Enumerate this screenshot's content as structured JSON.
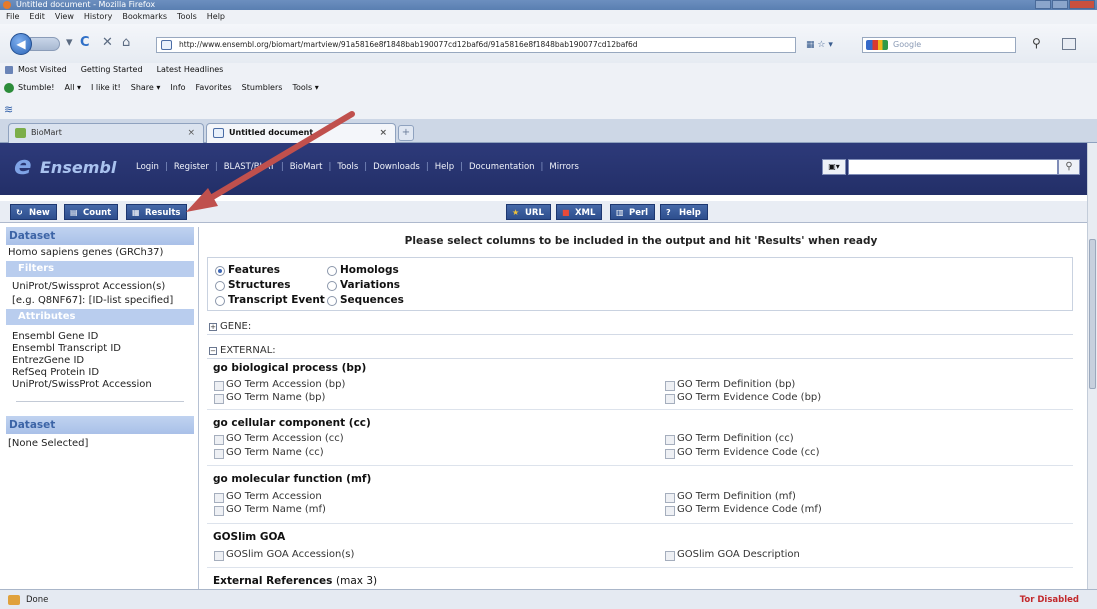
{
  "window": {
    "title": "Untitled document - Mozilla Firefox"
  },
  "menu": [
    "File",
    "Edit",
    "View",
    "History",
    "Bookmarks",
    "Tools",
    "Help"
  ],
  "navbar": {
    "url": "http://www.ensembl.org/biomart/martview/91a5816e8f1848bab190077cd12baf6d/91a5816e8f1848bab190077cd12baf6d",
    "search_placeholder": "Google"
  },
  "bookmarks": [
    "Most Visited",
    "Getting Started",
    "Latest Headlines"
  ],
  "stumble": [
    "Stumble!",
    "All ▾",
    "I like it!",
    "Share ▾",
    "Info",
    "Favorites",
    "Stumblers",
    "Tools ▾"
  ],
  "tabs": [
    {
      "label": "BioMart"
    },
    {
      "label": "Untitled document"
    }
  ],
  "ensembl": {
    "logo_e": "e",
    "logo_word": "Ensembl",
    "nav": [
      "Login",
      "Register",
      "BLAST/BLAT",
      "BioMart",
      "Tools",
      "Downloads",
      "Help",
      "Documentation",
      "Mirrors"
    ]
  },
  "toolbar": {
    "new": "New",
    "count": "Count",
    "results": "Results",
    "url": "URL",
    "xml": "XML",
    "perl": "Perl",
    "help": "Help"
  },
  "sidebar": {
    "dataset_head": "Dataset",
    "dataset_value": "Homo sapiens genes (GRCh37)",
    "filters_head": "Filters",
    "filter_line1": "UniProt/Swissprot Accession(s)",
    "filter_line2": "[e.g. Q8NF67]: [ID-list specified]",
    "attributes_head": "Attributes",
    "attributes": [
      "Ensembl Gene ID",
      "Ensembl Transcript ID",
      "EntrezGene ID",
      "RefSeq Protein ID",
      "UniProt/SwissProt Accession"
    ],
    "dataset2_head": "Dataset",
    "dataset2_value": "[None Selected]"
  },
  "main": {
    "heading": "Please select columns to be included in the output and hit 'Results' when ready",
    "attribute_types": [
      {
        "label": "Features",
        "selected": true
      },
      {
        "label": "Homologs",
        "selected": false
      },
      {
        "label": "Structures",
        "selected": false
      },
      {
        "label": "Variations",
        "selected": false
      },
      {
        "label": "Transcript Event",
        "selected": false
      },
      {
        "label": "Sequences",
        "selected": false
      }
    ],
    "gene_section": "GENE:",
    "external_section": "EXTERNAL:",
    "groups": [
      {
        "title": "go biological process (bp)",
        "left": [
          "GO Term Accession (bp)",
          "GO Term Name (bp)"
        ],
        "right": [
          "GO Term Definition (bp)",
          "GO Term Evidence Code (bp)"
        ]
      },
      {
        "title": "go cellular component (cc)",
        "left": [
          "GO Term Accession (cc)",
          "GO Term Name (cc)"
        ],
        "right": [
          "GO Term Definition (cc)",
          "GO Term Evidence Code (cc)"
        ]
      },
      {
        "title": "go molecular function (mf)",
        "left": [
          "GO Term Accession",
          "GO Term Name (mf)"
        ],
        "right": [
          "GO Term Definition (mf)",
          "GO Term Evidence Code (mf)"
        ]
      },
      {
        "title": "GOSlim GOA",
        "left": [
          "GOSlim GOA Accession(s)"
        ],
        "right": [
          "GOSlim GOA Description"
        ]
      }
    ],
    "ext_refs_title": "External References",
    "ext_refs_note": "(max 3)"
  },
  "status": {
    "left": "Done",
    "right": "Tor Disabled"
  },
  "colors": {
    "ensembl_header": "#2d3a7a",
    "annotation_arrow": "#c0504d",
    "sidebar_head": "#c0d3f0"
  }
}
